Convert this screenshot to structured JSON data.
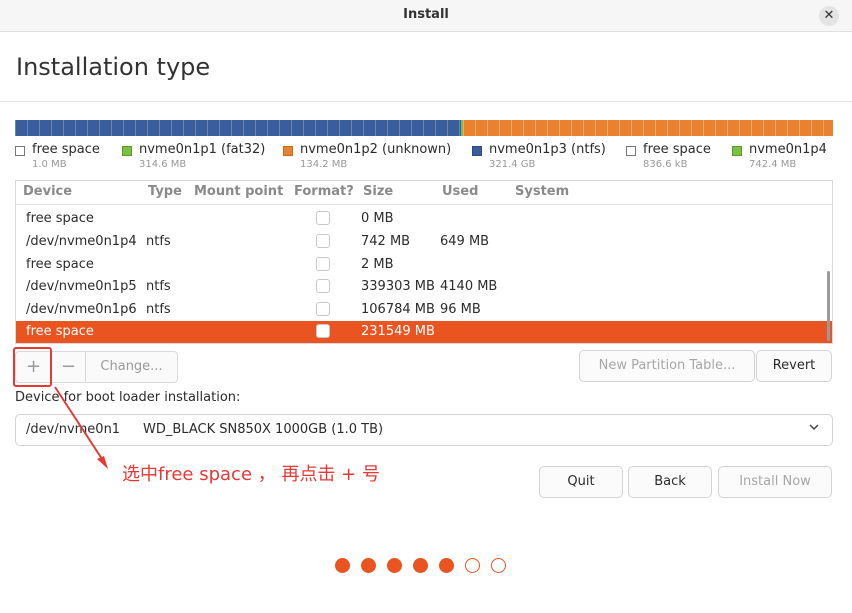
{
  "window": {
    "title": "Install",
    "close_label": "✕"
  },
  "page_title": "Installation type",
  "disk_segments": [
    {
      "color": "#3a5d9c",
      "fraction": 0.545
    },
    {
      "color": "#7ac142",
      "fraction": 0.003
    },
    {
      "color": "#e8822e",
      "fraction": 0.452
    }
  ],
  "legend": [
    {
      "name": "free space",
      "size": "1.0 MB",
      "color": "#ffffff"
    },
    {
      "name": "nvme0n1p1 (fat32)",
      "size": "314.6 MB",
      "color": "#7ac142"
    },
    {
      "name": "nvme0n1p2 (unknown)",
      "size": "134.2 MB",
      "color": "#e8822e"
    },
    {
      "name": "nvme0n1p3 (ntfs)",
      "size": "321.4 GB",
      "color": "#3a5d9c"
    },
    {
      "name": "free space",
      "size": "836.6 kB",
      "color": "#ffffff"
    },
    {
      "name": "nvme0n1p4",
      "size": "742.4 MB",
      "color": "#7ac142"
    }
  ],
  "table": {
    "headers": {
      "device": "Device",
      "type": "Type",
      "mount": "Mount point",
      "format": "Format?",
      "size": "Size",
      "used": "Used",
      "system": "System"
    },
    "rows": [
      {
        "device": "free space",
        "type": "",
        "size": "0 MB",
        "used": ""
      },
      {
        "device": "/dev/nvme0n1p4",
        "type": "ntfs",
        "size": "742 MB",
        "used": "649 MB"
      },
      {
        "device": "free space",
        "type": "",
        "size": "2 MB",
        "used": ""
      },
      {
        "device": "/dev/nvme0n1p5",
        "type": "ntfs",
        "size": "339303 MB",
        "used": "4140 MB"
      },
      {
        "device": "/dev/nvme0n1p6",
        "type": "ntfs",
        "size": "106784 MB",
        "used": "96 MB"
      },
      {
        "device": "free space",
        "type": "",
        "size": "231549 MB",
        "used": ""
      }
    ]
  },
  "toolbar": {
    "add": "+",
    "remove": "−",
    "change": "Change..."
  },
  "buttons": {
    "new_table": "New Partition Table...",
    "revert": "Revert",
    "quit": "Quit",
    "back": "Back",
    "install": "Install Now"
  },
  "boot_loader": {
    "label": "Device for boot loader installation:",
    "device": "/dev/nvme0n1",
    "model": "WD_BLACK SN850X 1000GB (1.0 TB)"
  },
  "annotation": {
    "text": "选中free space ， 再点击 + 号",
    "color": "#e53935"
  },
  "progress": {
    "total": 7,
    "completed": 5
  }
}
